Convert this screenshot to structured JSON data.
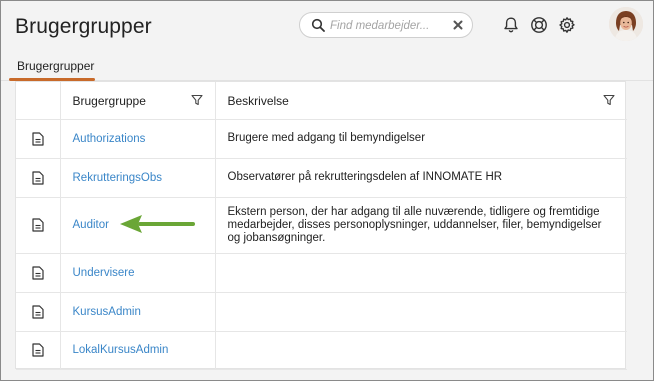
{
  "header": {
    "title": "Brugergrupper",
    "search": {
      "placeholder": "Find medarbejder..."
    },
    "icons": [
      "search-icon",
      "clear-icon",
      "bell-icon",
      "help-icon",
      "gear-icon"
    ]
  },
  "tabs": [
    {
      "label": "Brugergrupper",
      "active": true
    }
  ],
  "table": {
    "columns": [
      "Brugergruppe",
      "Beskrivelse"
    ],
    "rows": [
      {
        "name": "Authorizations",
        "description": "Brugere med adgang til bemyndigelser"
      },
      {
        "name": "RekrutteringsObs",
        "description": "Observatører på rekrutteringsdelen af INNOMATE HR"
      },
      {
        "name": "Auditor",
        "description": "Ekstern person, der har adgang til alle nuværende, tidligere og fremtidige medarbejder, disses personoplysninger, uddannelser, filer, bemyndigelser og jobansøgninger."
      },
      {
        "name": "Undervisere",
        "description": ""
      },
      {
        "name": "KursusAdmin",
        "description": ""
      },
      {
        "name": "LokalKursusAdmin",
        "description": ""
      }
    ]
  },
  "colors": {
    "link": "#3a86c8",
    "tab_accent": "#c86a2a",
    "annotation_arrow": "#6aa636",
    "background": "#f3f3f3"
  }
}
